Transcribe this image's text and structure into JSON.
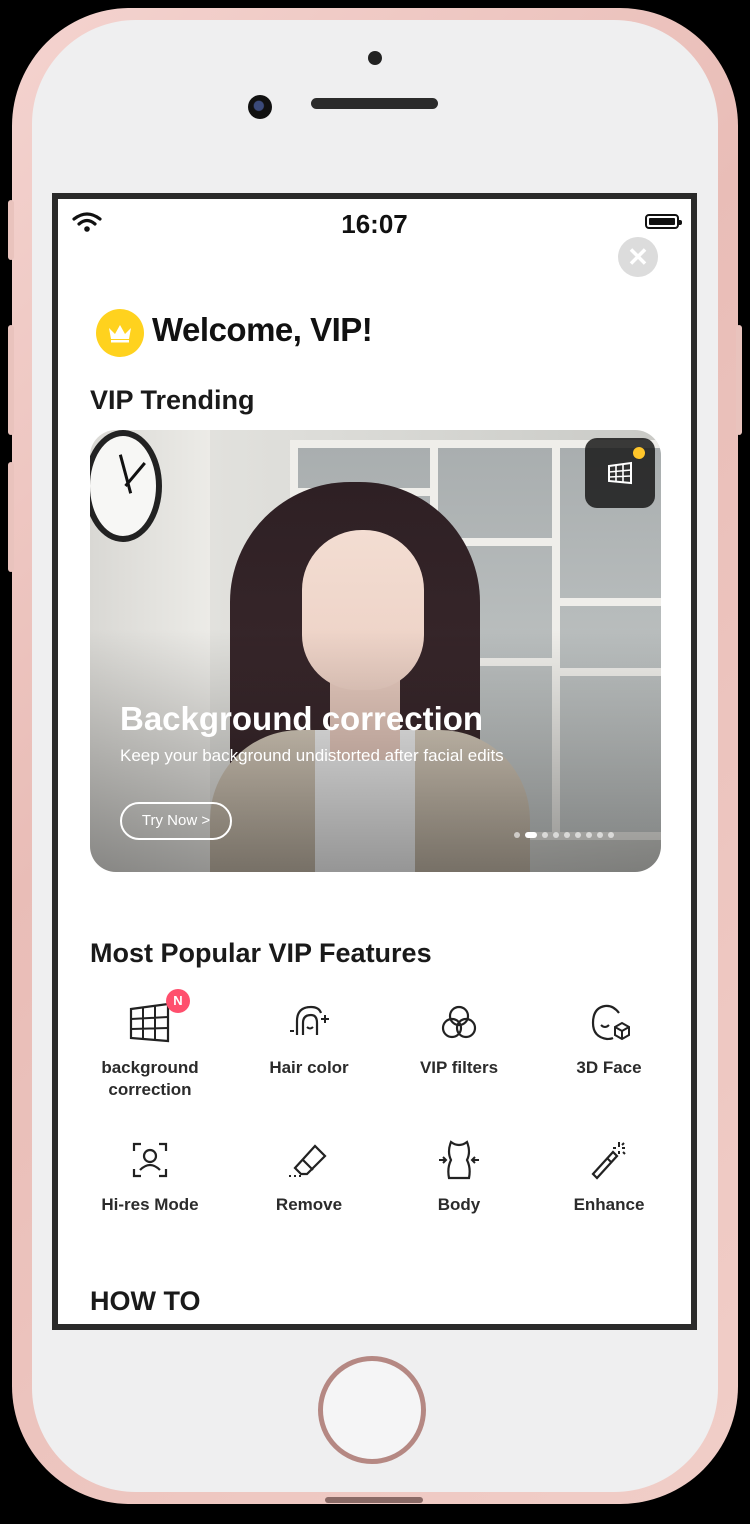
{
  "status_bar": {
    "time": "16:07"
  },
  "header": {
    "welcome": "Welcome, VIP!",
    "close_icon": "close-icon"
  },
  "sections": {
    "trending_title": "VIP Trending",
    "popular_title": "Most Popular VIP Features",
    "how_to_title": "HOW TO"
  },
  "banner": {
    "title": "Background correction",
    "subtitle": "Keep your background undistorted after facial edits",
    "cta": "Try Now >",
    "page_count": 9,
    "active_page": 1
  },
  "features": [
    {
      "label": "background correction",
      "icon": "grid-icon",
      "badge": "N"
    },
    {
      "label": "Hair color",
      "icon": "hair-icon"
    },
    {
      "label": "VIP filters",
      "icon": "filters-icon"
    },
    {
      "label": "3D Face",
      "icon": "3d-face-icon"
    },
    {
      "label": "Hi-res Mode",
      "icon": "face-scan-icon"
    },
    {
      "label": "Remove",
      "icon": "eraser-icon"
    },
    {
      "label": "Body",
      "icon": "body-icon"
    },
    {
      "label": "Enhance",
      "icon": "magic-wand-icon"
    }
  ],
  "colors": {
    "accent": "#ffd21e",
    "badge": "#ff4f6d"
  }
}
